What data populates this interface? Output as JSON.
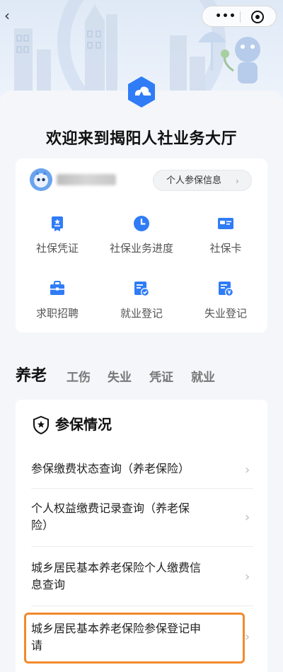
{
  "nav": {
    "back_glyph": "‹",
    "more_glyph": "•••"
  },
  "header": {
    "title": "欢迎来到揭阳人社业务大厅",
    "logo_icon": "hr-bureau-logo-icon"
  },
  "user_card": {
    "avatar_icon": "cartoon-avatar-icon",
    "info_button_label": "个人参保信息",
    "info_button_arrow": "›",
    "services": [
      {
        "label": "社保凭证",
        "icon": "certificate-icon"
      },
      {
        "label": "社保业务进度",
        "icon": "clock-icon"
      },
      {
        "label": "社保卡",
        "icon": "card-icon"
      },
      {
        "label": "求职招聘",
        "icon": "briefcase-icon"
      },
      {
        "label": "就业登记",
        "icon": "register-check-icon"
      },
      {
        "label": "失业登记",
        "icon": "register-yen-icon"
      }
    ]
  },
  "tabs": [
    {
      "label": "养老",
      "active": true
    },
    {
      "label": "工伤",
      "active": false
    },
    {
      "label": "失业",
      "active": false
    },
    {
      "label": "凭证",
      "active": false
    },
    {
      "label": "就业",
      "active": false
    }
  ],
  "section": {
    "title": "参保情况",
    "icon": "shield-star-icon",
    "rows": [
      {
        "line1": "参保缴费状态查询（养老保险）",
        "line2": ""
      },
      {
        "line1": "个人权益缴费记录查询（养老保",
        "line2": "险）"
      },
      {
        "line1": "城乡居民基本养老保险个人缴费信",
        "line2": "息查询"
      },
      {
        "line1": "城乡居民基本养老保险参保登记申",
        "line2": "请"
      }
    ],
    "chevron": "›"
  },
  "colors": {
    "accent": "#2f7cf6",
    "highlight": "#f28a2c",
    "background": "#f4f6fa"
  }
}
